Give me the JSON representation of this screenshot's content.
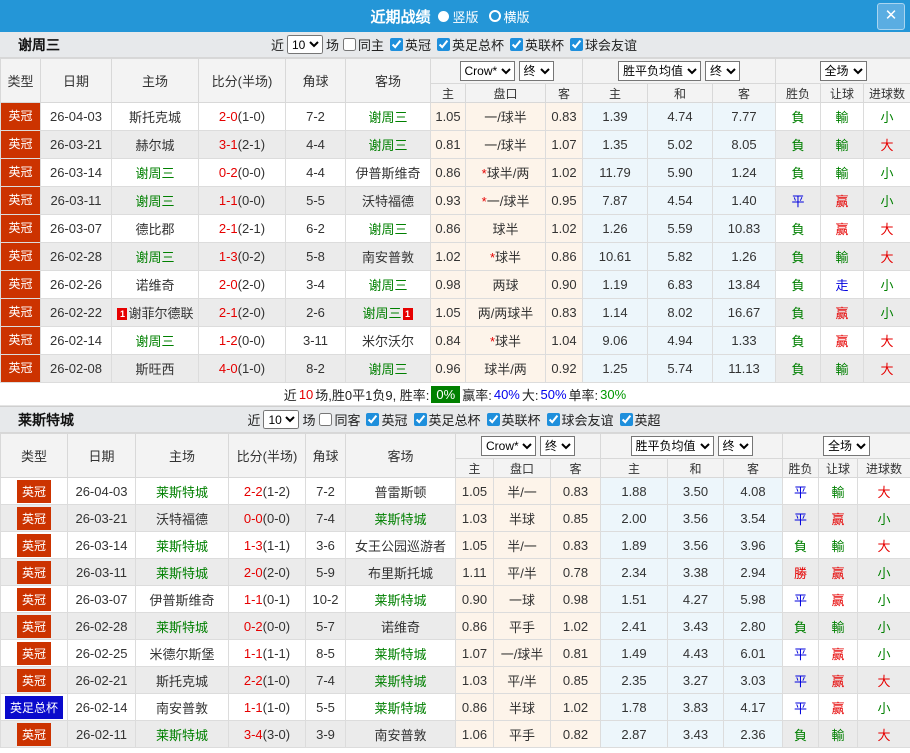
{
  "titlebar": {
    "title": "近期战绩",
    "layout_options": [
      {
        "label": "竖版",
        "selected": true
      },
      {
        "label": "横版",
        "selected": false
      }
    ],
    "close_icon": "✕"
  },
  "colors": {
    "accent_blue": "#2496d7",
    "league_badge_red": "#cc3300",
    "league_badge_blue": "#0a0acc",
    "team_green": "#008000",
    "score_red": "#e60000",
    "result_win_red": "#e60000",
    "result_draw_blue": "#0000dd",
    "result_lose_green": "#008000",
    "summary_badge_green": "#008000",
    "odds_col_bg": "#fdf4ea",
    "mean_col_bg": "#edf6fb"
  },
  "table_header": {
    "static_cols": [
      "类型",
      "日期",
      "主场",
      "比分(半场)",
      "角球",
      "客场"
    ],
    "odds_company_select": "Crow*",
    "odds_final_select": "终",
    "mean_select": "胜平负均值",
    "mean_final_select": "终",
    "scope_select": "全场",
    "sub_cols": [
      "主",
      "盘口",
      "客",
      "主",
      "和",
      "客",
      "胜负",
      "让球",
      "进球数"
    ]
  },
  "sections": [
    {
      "team": "谢周三",
      "filter": {
        "near_label": "近",
        "match_count": "10",
        "games_label": "场",
        "same_venue_label": "同主",
        "same_venue_checked": false,
        "leagues": [
          {
            "label": "英冠",
            "checked": true
          },
          {
            "label": "英足总杯",
            "checked": true
          },
          {
            "label": "英联杯",
            "checked": true
          },
          {
            "label": "球会友谊",
            "checked": true
          }
        ]
      },
      "rows": [
        {
          "lg": "英冠",
          "lgc": "red",
          "date": "26-04-03",
          "home": "斯托克城",
          "hg": false,
          "hcard": "",
          "score": "2-0",
          "half": "(1-0)",
          "cor": "7-2",
          "away": "谢周三",
          "ag": true,
          "acard": "",
          "o1": "1.05",
          "hc": "一/球半",
          "star": false,
          "o2": "0.83",
          "m1": "1.39",
          "m2": "4.74",
          "m3": "7.77",
          "res": [
            "負",
            "輸",
            "小"
          ],
          "rc": [
            "g",
            "g",
            "g"
          ]
        },
        {
          "lg": "英冠",
          "lgc": "red",
          "date": "26-03-21",
          "home": "赫尔城",
          "hg": false,
          "hcard": "",
          "score": "3-1",
          "half": "(2-1)",
          "cor": "4-4",
          "away": "谢周三",
          "ag": true,
          "acard": "",
          "o1": "0.81",
          "hc": "一/球半",
          "star": false,
          "o2": "1.07",
          "m1": "1.35",
          "m2": "5.02",
          "m3": "8.05",
          "res": [
            "負",
            "輸",
            "大"
          ],
          "rc": [
            "g",
            "g",
            "r"
          ]
        },
        {
          "lg": "英冠",
          "lgc": "red",
          "date": "26-03-14",
          "home": "谢周三",
          "hg": true,
          "hcard": "",
          "score": "0-2",
          "half": "(0-0)",
          "cor": "4-4",
          "away": "伊普斯维奇",
          "ag": false,
          "acard": "",
          "o1": "0.86",
          "hc": "球半/两",
          "star": true,
          "o2": "1.02",
          "m1": "11.79",
          "m2": "5.90",
          "m3": "1.24",
          "res": [
            "負",
            "輸",
            "小"
          ],
          "rc": [
            "g",
            "g",
            "g"
          ]
        },
        {
          "lg": "英冠",
          "lgc": "red",
          "date": "26-03-11",
          "home": "谢周三",
          "hg": true,
          "hcard": "",
          "score": "1-1",
          "half": "(0-0)",
          "cor": "5-5",
          "away": "沃特福德",
          "ag": false,
          "acard": "",
          "o1": "0.93",
          "hc": "一/球半",
          "star": true,
          "o2": "0.95",
          "m1": "7.87",
          "m2": "4.54",
          "m3": "1.40",
          "res": [
            "平",
            "赢",
            "小"
          ],
          "rc": [
            "b",
            "r",
            "g"
          ]
        },
        {
          "lg": "英冠",
          "lgc": "red",
          "date": "26-03-07",
          "home": "德比郡",
          "hg": false,
          "hcard": "",
          "score": "2-1",
          "half": "(2-1)",
          "cor": "6-2",
          "away": "谢周三",
          "ag": true,
          "acard": "",
          "o1": "0.86",
          "hc": "球半",
          "star": false,
          "o2": "1.02",
          "m1": "1.26",
          "m2": "5.59",
          "m3": "10.83",
          "res": [
            "負",
            "赢",
            "大"
          ],
          "rc": [
            "g",
            "r",
            "r"
          ]
        },
        {
          "lg": "英冠",
          "lgc": "red",
          "date": "26-02-28",
          "home": "谢周三",
          "hg": true,
          "hcard": "",
          "score": "1-3",
          "half": "(0-2)",
          "cor": "5-8",
          "away": "南安普敦",
          "ag": false,
          "acard": "",
          "o1": "1.02",
          "hc": "球半",
          "star": true,
          "o2": "0.86",
          "m1": "10.61",
          "m2": "5.82",
          "m3": "1.26",
          "res": [
            "負",
            "輸",
            "大"
          ],
          "rc": [
            "g",
            "g",
            "r"
          ]
        },
        {
          "lg": "英冠",
          "lgc": "red",
          "date": "26-02-26",
          "home": "诺维奇",
          "hg": false,
          "hcard": "",
          "score": "2-0",
          "half": "(2-0)",
          "cor": "3-4",
          "away": "谢周三",
          "ag": true,
          "acard": "",
          "o1": "0.98",
          "hc": "两球",
          "star": false,
          "o2": "0.90",
          "m1": "1.19",
          "m2": "6.83",
          "m3": "13.84",
          "res": [
            "負",
            "走",
            "小"
          ],
          "rc": [
            "g",
            "b",
            "g"
          ]
        },
        {
          "lg": "英冠",
          "lgc": "red",
          "date": "26-02-22",
          "home": "谢菲尔德联",
          "hg": false,
          "hcard": "1",
          "score": "2-1",
          "half": "(2-0)",
          "cor": "2-6",
          "away": "谢周三",
          "ag": true,
          "acard": "1",
          "o1": "1.05",
          "hc": "两/两球半",
          "star": false,
          "o2": "0.83",
          "m1": "1.14",
          "m2": "8.02",
          "m3": "16.67",
          "res": [
            "負",
            "赢",
            "小"
          ],
          "rc": [
            "g",
            "r",
            "g"
          ]
        },
        {
          "lg": "英冠",
          "lgc": "red",
          "date": "26-02-14",
          "home": "谢周三",
          "hg": true,
          "hcard": "",
          "score": "1-2",
          "half": "(0-0)",
          "cor": "3-11",
          "away": "米尔沃尔",
          "ag": false,
          "acard": "",
          "o1": "0.84",
          "hc": "球半",
          "star": true,
          "o2": "1.04",
          "m1": "9.06",
          "m2": "4.94",
          "m3": "1.33",
          "res": [
            "負",
            "赢",
            "大"
          ],
          "rc": [
            "g",
            "r",
            "r"
          ]
        },
        {
          "lg": "英冠",
          "lgc": "red",
          "date": "26-02-08",
          "home": "斯旺西",
          "hg": false,
          "hcard": "",
          "score": "4-0",
          "half": "(1-0)",
          "cor": "8-2",
          "away": "谢周三",
          "ag": true,
          "acard": "",
          "o1": "0.96",
          "hc": "球半/两",
          "star": false,
          "o2": "0.92",
          "m1": "1.25",
          "m2": "5.74",
          "m3": "11.13",
          "res": [
            "負",
            "輸",
            "大"
          ],
          "rc": [
            "g",
            "g",
            "r"
          ]
        }
      ],
      "summary_parts": [
        {
          "text": "近",
          "style": "black"
        },
        {
          "text": "10",
          "style": "red"
        },
        {
          "text": "场,胜0平1负9, 胜率:",
          "style": "black"
        },
        {
          "text": "0%",
          "style": "badge"
        },
        {
          "text": "赢率:",
          "style": "black"
        },
        {
          "text": "40%",
          "style": "blue"
        },
        {
          "text": "大:",
          "style": "black"
        },
        {
          "text": "50%",
          "style": "blue"
        },
        {
          "text": "单率:",
          "style": "black"
        },
        {
          "text": "30%",
          "style": "green"
        }
      ]
    },
    {
      "team": "莱斯特城",
      "filter": {
        "near_label": "近",
        "match_count": "10",
        "games_label": "场",
        "same_venue_label": "同客",
        "same_venue_checked": false,
        "leagues": [
          {
            "label": "英冠",
            "checked": true
          },
          {
            "label": "英足总杯",
            "checked": true
          },
          {
            "label": "英联杯",
            "checked": true
          },
          {
            "label": "球会友谊",
            "checked": true
          },
          {
            "label": "英超",
            "checked": true
          }
        ]
      },
      "rows": [
        {
          "lg": "英冠",
          "lgc": "red",
          "date": "26-04-03",
          "home": "莱斯特城",
          "hg": true,
          "hcard": "",
          "score": "2-2",
          "half": "(1-2)",
          "cor": "7-2",
          "away": "普雷斯顿",
          "ag": false,
          "acard": "",
          "o1": "1.05",
          "hc": "半/一",
          "star": false,
          "o2": "0.83",
          "m1": "1.88",
          "m2": "3.50",
          "m3": "4.08",
          "res": [
            "平",
            "輸",
            "大"
          ],
          "rc": [
            "b",
            "g",
            "r"
          ]
        },
        {
          "lg": "英冠",
          "lgc": "red",
          "date": "26-03-21",
          "home": "沃特福德",
          "hg": false,
          "hcard": "",
          "score": "0-0",
          "half": "(0-0)",
          "cor": "7-4",
          "away": "莱斯特城",
          "ag": true,
          "acard": "",
          "o1": "1.03",
          "hc": "半球",
          "star": false,
          "o2": "0.85",
          "m1": "2.00",
          "m2": "3.56",
          "m3": "3.54",
          "res": [
            "平",
            "赢",
            "小"
          ],
          "rc": [
            "b",
            "r",
            "g"
          ]
        },
        {
          "lg": "英冠",
          "lgc": "red",
          "date": "26-03-14",
          "home": "莱斯特城",
          "hg": true,
          "hcard": "",
          "score": "1-3",
          "half": "(1-1)",
          "cor": "3-6",
          "away": "女王公园巡游者",
          "ag": false,
          "acard": "",
          "o1": "1.05",
          "hc": "半/一",
          "star": false,
          "o2": "0.83",
          "m1": "1.89",
          "m2": "3.56",
          "m3": "3.96",
          "res": [
            "負",
            "輸",
            "大"
          ],
          "rc": [
            "g",
            "g",
            "r"
          ]
        },
        {
          "lg": "英冠",
          "lgc": "red",
          "date": "26-03-11",
          "home": "莱斯特城",
          "hg": true,
          "hcard": "",
          "score": "2-0",
          "half": "(2-0)",
          "cor": "5-9",
          "away": "布里斯托城",
          "ag": false,
          "acard": "",
          "o1": "1.11",
          "hc": "平/半",
          "star": false,
          "o2": "0.78",
          "m1": "2.34",
          "m2": "3.38",
          "m3": "2.94",
          "res": [
            "勝",
            "赢",
            "小"
          ],
          "rc": [
            "r",
            "r",
            "g"
          ]
        },
        {
          "lg": "英冠",
          "lgc": "red",
          "date": "26-03-07",
          "home": "伊普斯维奇",
          "hg": false,
          "hcard": "",
          "score": "1-1",
          "half": "(0-1)",
          "cor": "10-2",
          "away": "莱斯特城",
          "ag": true,
          "acard": "",
          "o1": "0.90",
          "hc": "一球",
          "star": false,
          "o2": "0.98",
          "m1": "1.51",
          "m2": "4.27",
          "m3": "5.98",
          "res": [
            "平",
            "赢",
            "小"
          ],
          "rc": [
            "b",
            "r",
            "g"
          ]
        },
        {
          "lg": "英冠",
          "lgc": "red",
          "date": "26-02-28",
          "home": "莱斯特城",
          "hg": true,
          "hcard": "",
          "score": "0-2",
          "half": "(0-0)",
          "cor": "5-7",
          "away": "诺维奇",
          "ag": false,
          "acard": "",
          "o1": "0.86",
          "hc": "平手",
          "star": false,
          "o2": "1.02",
          "m1": "2.41",
          "m2": "3.43",
          "m3": "2.80",
          "res": [
            "負",
            "輸",
            "小"
          ],
          "rc": [
            "g",
            "g",
            "g"
          ]
        },
        {
          "lg": "英冠",
          "lgc": "red",
          "date": "26-02-25",
          "home": "米德尔斯堡",
          "hg": false,
          "hcard": "",
          "score": "1-1",
          "half": "(1-1)",
          "cor": "8-5",
          "away": "莱斯特城",
          "ag": true,
          "acard": "",
          "o1": "1.07",
          "hc": "一/球半",
          "star": false,
          "o2": "0.81",
          "m1": "1.49",
          "m2": "4.43",
          "m3": "6.01",
          "res": [
            "平",
            "赢",
            "小"
          ],
          "rc": [
            "b",
            "r",
            "g"
          ]
        },
        {
          "lg": "英冠",
          "lgc": "red",
          "date": "26-02-21",
          "home": "斯托克城",
          "hg": false,
          "hcard": "",
          "score": "2-2",
          "half": "(1-0)",
          "cor": "7-4",
          "away": "莱斯特城",
          "ag": true,
          "acard": "",
          "o1": "1.03",
          "hc": "平/半",
          "star": false,
          "o2": "0.85",
          "m1": "2.35",
          "m2": "3.27",
          "m3": "3.03",
          "res": [
            "平",
            "赢",
            "大"
          ],
          "rc": [
            "b",
            "r",
            "r"
          ]
        },
        {
          "lg": "英足总杯",
          "lgc": "blue",
          "date": "26-02-14",
          "home": "南安普敦",
          "hg": false,
          "hcard": "",
          "score": "1-1",
          "half": "(1-0)",
          "cor": "5-5",
          "away": "莱斯特城",
          "ag": true,
          "acard": "",
          "o1": "0.86",
          "hc": "半球",
          "star": false,
          "o2": "1.02",
          "m1": "1.78",
          "m2": "3.83",
          "m3": "4.17",
          "res": [
            "平",
            "赢",
            "小"
          ],
          "rc": [
            "b",
            "r",
            "g"
          ]
        },
        {
          "lg": "英冠",
          "lgc": "red",
          "date": "26-02-11",
          "home": "莱斯特城",
          "hg": true,
          "hcard": "",
          "score": "3-4",
          "half": "(3-0)",
          "cor": "3-9",
          "away": "南安普敦",
          "ag": false,
          "acard": "",
          "o1": "1.06",
          "hc": "平手",
          "star": false,
          "o2": "0.82",
          "m1": "2.87",
          "m2": "3.43",
          "m3": "2.36",
          "res": [
            "負",
            "輸",
            "大"
          ],
          "rc": [
            "g",
            "g",
            "r"
          ]
        }
      ]
    }
  ]
}
